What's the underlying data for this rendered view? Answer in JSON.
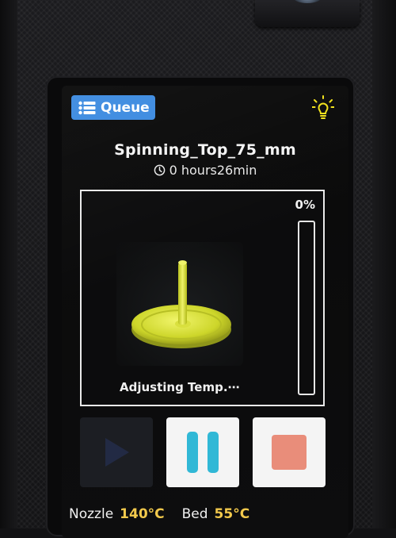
{
  "header": {
    "queue_label": "Queue",
    "queue_icon": "list-icon",
    "light_icon": "lightbulb-icon",
    "light_icon_color": "#f2e21a"
  },
  "job": {
    "file_name": "Spinning_Top_75_mm",
    "time_icon": "clock-icon",
    "time_remaining": "0 hours26min"
  },
  "preview": {
    "model_color": "#d8e23a",
    "status_text": "Adjusting Temp.⋯"
  },
  "progress": {
    "percent_label": "0%",
    "value": 0,
    "fill_color": "#4ab7e6"
  },
  "controls": {
    "play_icon": "play-icon",
    "pause_icon": "pause-icon",
    "stop_icon": "stop-icon",
    "pause_color": "#31b8d6",
    "stop_color": "#e98d7a"
  },
  "temps": {
    "nozzle_label": "Nozzle",
    "nozzle_value": "140°C",
    "bed_label": "Bed",
    "bed_value": "55°C",
    "value_color": "#f2c94c"
  }
}
